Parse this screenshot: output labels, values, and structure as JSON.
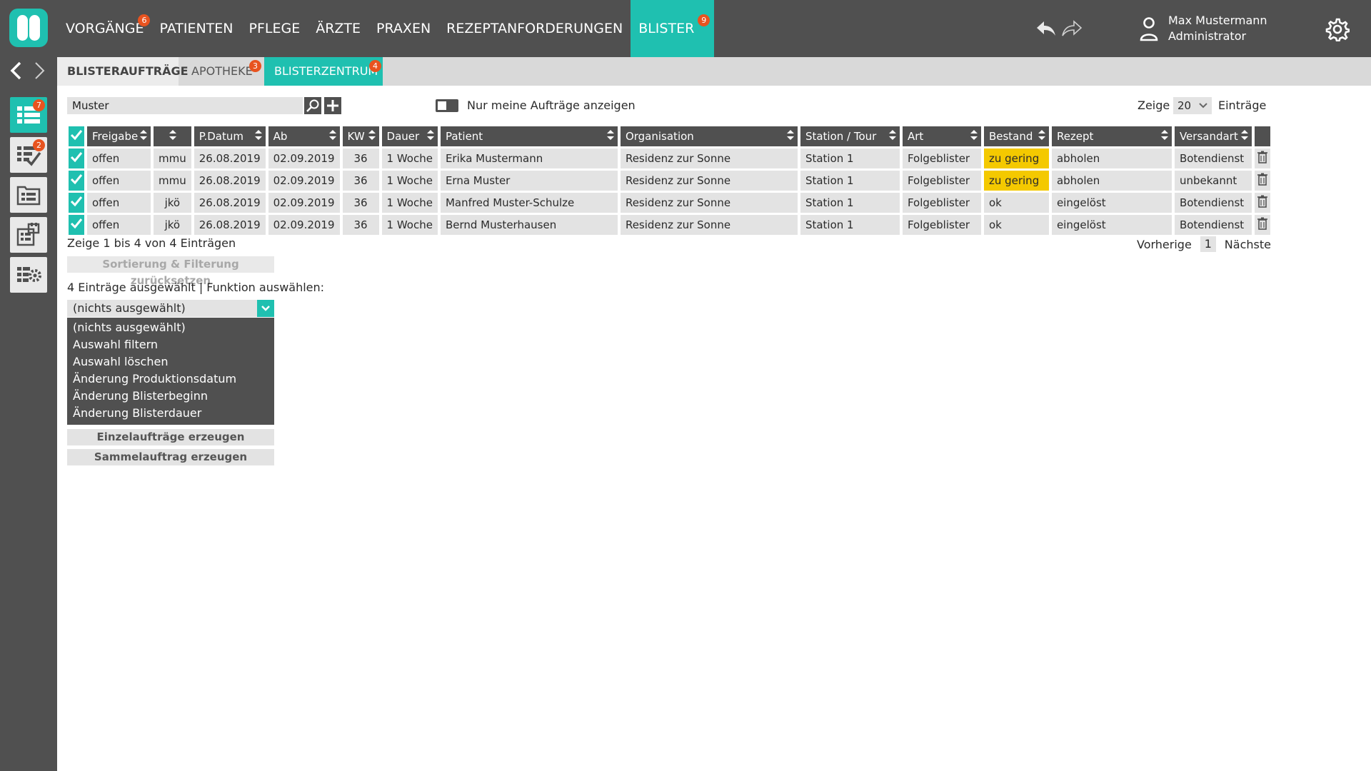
{
  "topnav": {
    "items": [
      {
        "label": "VORGÄNGE",
        "badge": "6"
      },
      {
        "label": "PATIENTEN",
        "badge": ""
      },
      {
        "label": "PFLEGE",
        "badge": ""
      },
      {
        "label": "ÄRZTE",
        "badge": ""
      },
      {
        "label": "PRAXEN",
        "badge": ""
      },
      {
        "label": "REZEPTANFORDERUNGEN",
        "badge": ""
      },
      {
        "label": "BLISTER",
        "badge": "9"
      }
    ],
    "active": "BLISTER"
  },
  "user": {
    "name": "Max Mustermann",
    "role": "Administrator"
  },
  "sidebar": {
    "badges": {
      "blister": "7",
      "checklist": "2"
    }
  },
  "tabs": [
    {
      "label": "BLISTERAUFTRÄGE",
      "badge": ""
    },
    {
      "label": "APOTHEKE",
      "badge": "3"
    },
    {
      "label": "BLISTERZENTRUM",
      "badge": "4"
    }
  ],
  "toolbar": {
    "search_value": "Muster",
    "toggle_label": "Nur meine Aufträge anzeigen",
    "show_label": "Zeige",
    "page_length": "20",
    "entries_label": "Einträge"
  },
  "table": {
    "columns": [
      "Freigabe",
      "",
      "P.Datum",
      "Ab",
      "KW",
      "Dauer",
      "Patient",
      "Organisation",
      "Station / Tour",
      "Art",
      "Bestand",
      "Rezept",
      "Versandart"
    ],
    "rows": [
      {
        "freigabe": "offen",
        "kuerzel": "mmu",
        "pdatum": "26.08.2019",
        "ab": "02.09.2019",
        "kw": "36",
        "dauer": "1 Woche",
        "patient": "Erika Mustermann",
        "organisation": "Residenz zur Sonne",
        "station": "Station 1",
        "art": "Folgeblister",
        "bestand": "zu gering",
        "rezept": "abholen",
        "versandart": "Botendienst"
      },
      {
        "freigabe": "offen",
        "kuerzel": "mmu",
        "pdatum": "26.08.2019",
        "ab": "02.09.2019",
        "kw": "36",
        "dauer": "1 Woche",
        "patient": "Erna Muster",
        "organisation": "Residenz zur Sonne",
        "station": "Station 1",
        "art": "Folgeblister",
        "bestand": "zu gering",
        "rezept": "abholen",
        "versandart": "unbekannt"
      },
      {
        "freigabe": "offen",
        "kuerzel": "jkö",
        "pdatum": "26.08.2019",
        "ab": "02.09.2019",
        "kw": "36",
        "dauer": "1 Woche",
        "patient": "Manfred Muster-Schulze",
        "organisation": "Residenz zur Sonne",
        "station": "Station 1",
        "art": "Folgeblister",
        "bestand": "ok",
        "rezept": "eingelöst",
        "versandart": "Botendienst"
      },
      {
        "freigabe": "offen",
        "kuerzel": "jkö",
        "pdatum": "26.08.2019",
        "ab": "02.09.2019",
        "kw": "36",
        "dauer": "1 Woche",
        "patient": "Bernd Musterhausen",
        "organisation": "Residenz zur Sonne",
        "station": "Station 1",
        "art": "Folgeblister",
        "bestand": "ok",
        "rezept": "eingelöst",
        "versandart": "Botendienst"
      }
    ]
  },
  "footer": {
    "info": "Zeige 1 bis 4 von 4 Einträgen",
    "prev": "Vorherige",
    "page": "1",
    "next": "Nächste",
    "reset": "Sortierung & Filterung zurücksetzen",
    "selection_info": "4 Einträge ausgewählt | Funktion auswählen:",
    "function_selected": "(nichts ausgewählt)",
    "function_options": [
      "(nichts ausgewählt)",
      "Auswahl filtern",
      "Auswahl löschen",
      "Änderung Produktionsdatum",
      "Änderung Blisterbeginn",
      "Änderung Blisterdauer"
    ],
    "single_orders": "Einzelaufträge erzeugen",
    "collective_order": "Sammelauftrag erzeugen"
  },
  "colors": {
    "accent": "#1fc0b0",
    "dark": "#505050",
    "badge": "#e8531f",
    "warning": "#f4c900"
  }
}
